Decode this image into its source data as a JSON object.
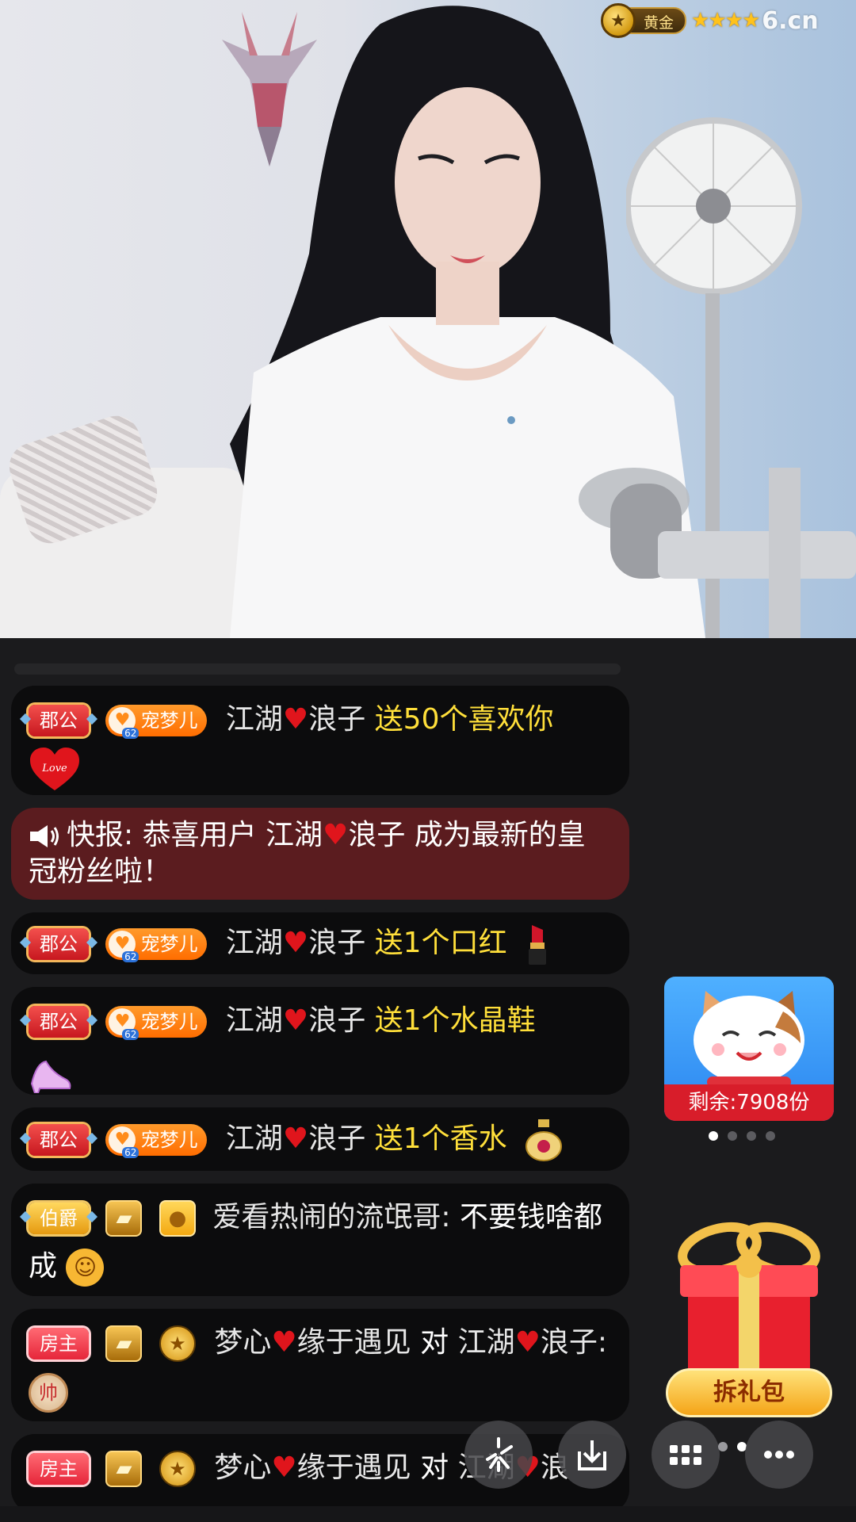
{
  "overlay": {
    "rank_label": "黄金",
    "stars": "★★★★",
    "site_logo": "6.cn"
  },
  "chat": {
    "messages": [
      {
        "title": "郡公",
        "fan_label": "宠梦儿",
        "fan_level": "62",
        "user": "江湖",
        "user2": "浪子",
        "action": "送50个喜欢你",
        "gift": "heart-love"
      },
      {
        "alert_prefix": "快报: 恭喜用户 江湖",
        "alert_suffix": "浪子 成为最新的皇冠粉丝啦！"
      },
      {
        "title": "郡公",
        "fan_label": "宠梦儿",
        "fan_level": "62",
        "user": "江湖",
        "user2": "浪子",
        "action": "送1个口红",
        "gift": "lipstick"
      },
      {
        "title": "郡公",
        "fan_label": "宠梦儿",
        "fan_level": "62",
        "user": "江湖",
        "user2": "浪子",
        "action": "送1个水晶鞋",
        "gift": "crystal-shoe"
      },
      {
        "title": "郡公",
        "fan_label": "宠梦儿",
        "fan_level": "62",
        "user": "江湖",
        "user2": "浪子",
        "action": "送1个香水",
        "gift": "perfume"
      },
      {
        "title": "伯爵",
        "user": "爱看热闹的流氓哥:",
        "text": " 不要钱啥都成"
      },
      {
        "title": "房主",
        "user": "梦心",
        "user2": "缘于遇见",
        "to": " 对 ",
        "target": "江湖",
        "target2": "浪子:",
        "emote": "帅"
      },
      {
        "title": "房主",
        "user": "梦心",
        "user2": "缘于遇见",
        "to": " 对 ",
        "target": "江湖",
        "target2": "浪"
      }
    ]
  },
  "promo": {
    "remain": "剩余:7908份"
  },
  "giftbox": {
    "button": "拆礼包"
  },
  "colors": {
    "gift_text": "#ffdf3a",
    "alert_bg": "#5b1c1f",
    "heart": "#e0151c"
  }
}
